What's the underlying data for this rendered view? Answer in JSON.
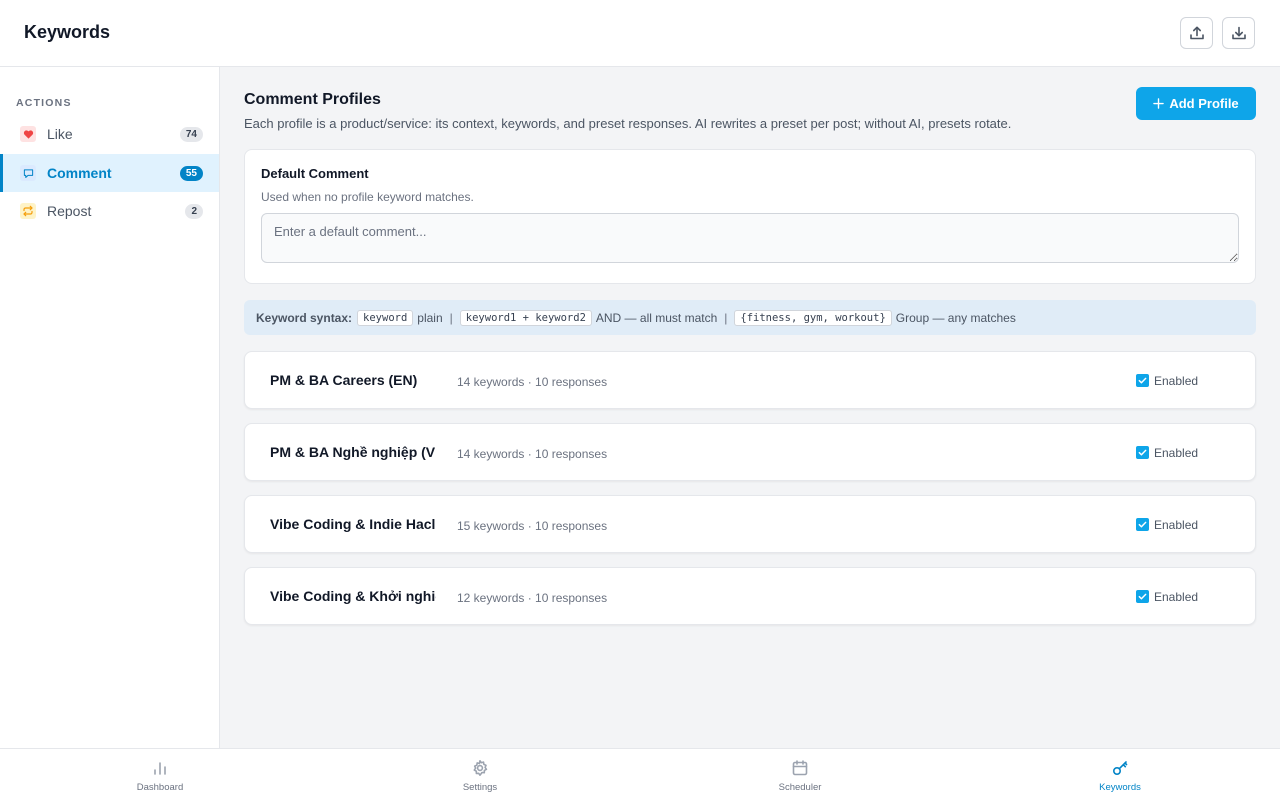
{
  "header": {
    "title": "Keywords",
    "upload_icon": "upload-icon",
    "download_icon": "download-icon"
  },
  "sidebar": {
    "section_label": "ACTIONS",
    "items": [
      {
        "label": "Like",
        "count": "74",
        "icon": "heart-icon",
        "active": false
      },
      {
        "label": "Comment",
        "count": "55",
        "icon": "comment-icon",
        "active": true
      },
      {
        "label": "Repost",
        "count": "2",
        "icon": "repost-icon",
        "active": false
      }
    ]
  },
  "main": {
    "title": "Comment Profiles",
    "subtitle": "Each profile is a product/service: its context, keywords, and preset responses. AI rewrites a preset per post; without AI, presets rotate.",
    "add_button": "Add Profile",
    "default_comment": {
      "title": "Default Comment",
      "help": "Used when no profile keyword matches.",
      "placeholder": "Enter a default comment...",
      "value": ""
    },
    "syntax": {
      "label": "Keyword syntax:",
      "ex1": "keyword",
      "ex1_desc": "plain",
      "ex2": "keyword1 + keyword2",
      "ex2_desc": "AND — all must match",
      "ex3": "{fitness, gym, workout}",
      "ex3_desc": "Group — any matches",
      "sep": "|"
    },
    "profiles": [
      {
        "name": "PM & BA Careers (EN)",
        "meta": "14 keywords · 10 responses",
        "enabled_label": "Enabled",
        "enabled": true
      },
      {
        "name": "PM & BA Nghề nghiệp (V",
        "meta": "14 keywords · 10 responses",
        "enabled_label": "Enabled",
        "enabled": true
      },
      {
        "name": "Vibe Coding & Indie Hacl",
        "meta": "15 keywords · 10 responses",
        "enabled_label": "Enabled",
        "enabled": true
      },
      {
        "name": "Vibe Coding & Khởi nghiệ",
        "meta": "12 keywords · 10 responses",
        "enabled_label": "Enabled",
        "enabled": true
      }
    ]
  },
  "bottom_nav": [
    {
      "label": "Dashboard",
      "icon": "bar-chart-icon",
      "active": false
    },
    {
      "label": "Settings",
      "icon": "gear-icon",
      "active": false
    },
    {
      "label": "Scheduler",
      "icon": "calendar-icon",
      "active": false
    },
    {
      "label": "Keywords",
      "icon": "key-icon",
      "active": true
    }
  ],
  "colors": {
    "accent": "#0284c7",
    "button": "#0ea5e9",
    "like": "#ef4444",
    "repost": "#f59e0b"
  }
}
